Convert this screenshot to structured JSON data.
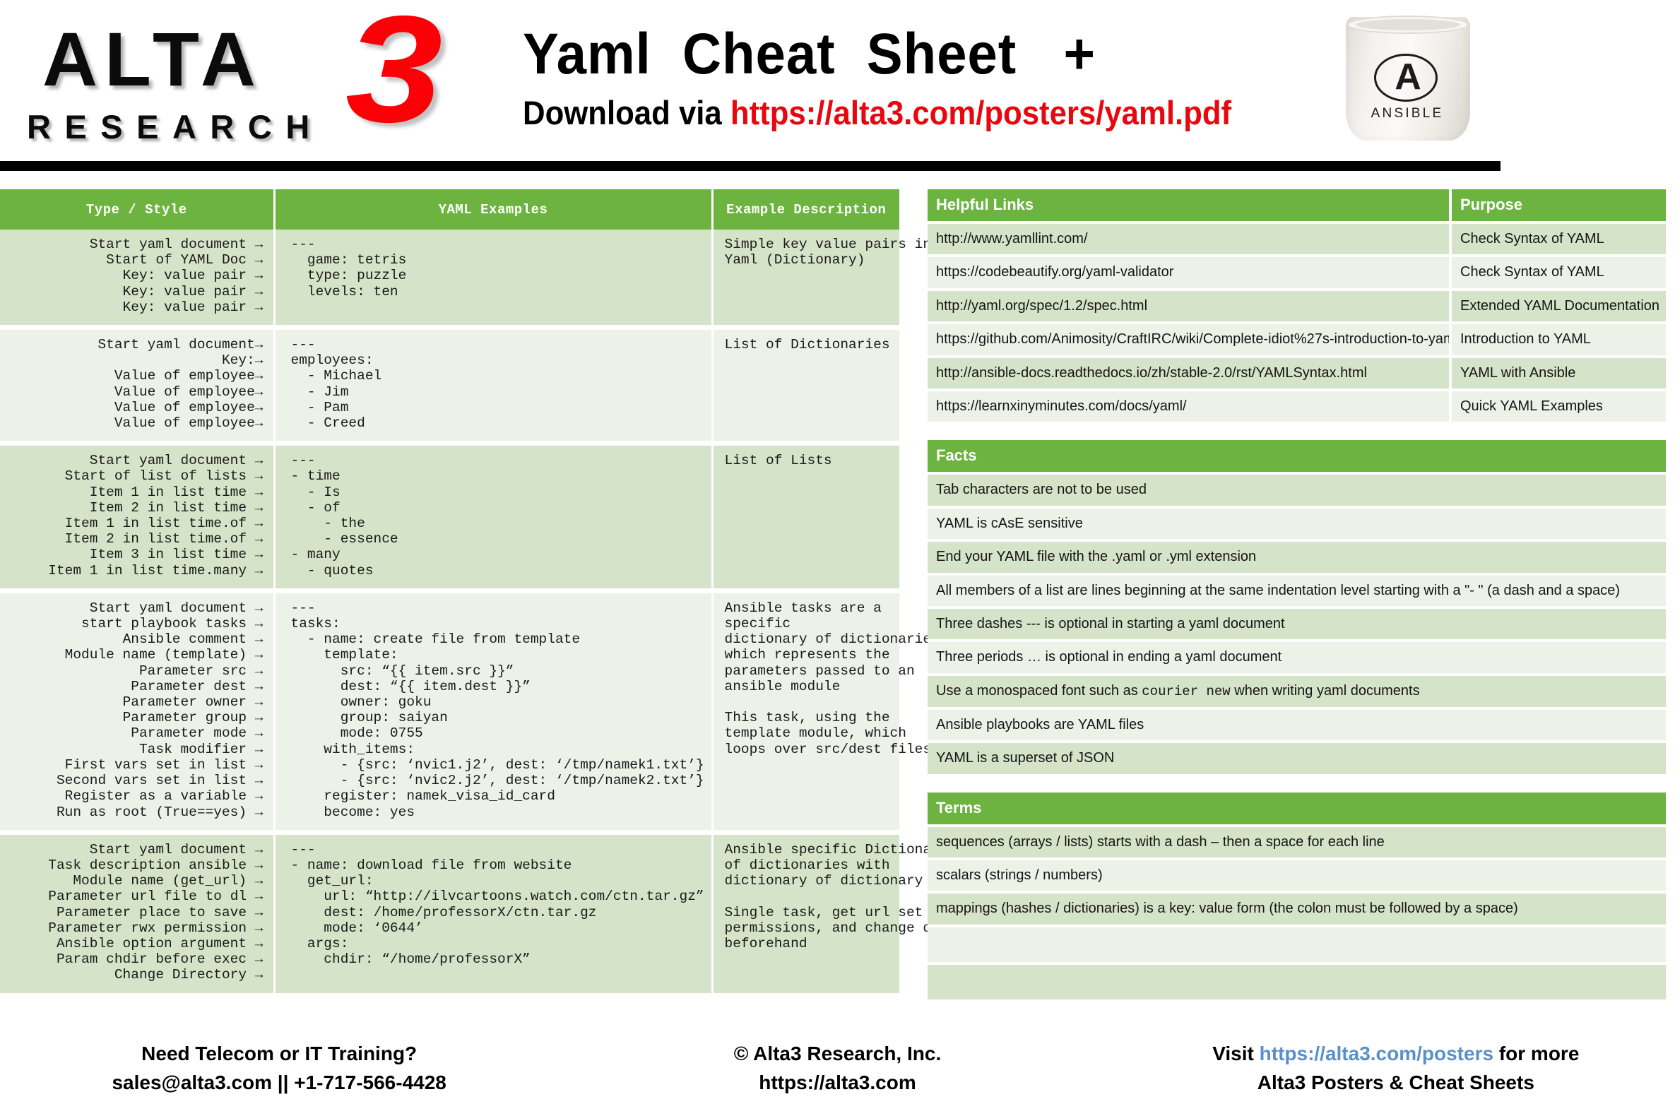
{
  "header": {
    "logo_alta": "ALTA",
    "logo_research": "RESEARCH",
    "logo_three": "3",
    "title": "Yaml  Cheat  Sheet   +",
    "subtitle_prefix": "Download via ",
    "subtitle_url": "https://alta3.com/posters/yaml.pdf",
    "mug_logo_mark": "A",
    "mug_logo_text": "ANSIBLE"
  },
  "cheat_table": {
    "headers": [
      "Type / Style",
      "YAML Examples",
      "Example Description"
    ],
    "rows": [
      {
        "type": "Start yaml document →\nStart of YAML Doc →\nKey: value pair →\nKey: value pair →\nKey: value pair →",
        "yaml": "---\n  game: tetris\n  type: puzzle\n  levels: ten",
        "desc": "Simple key value pairs in\nYaml (Dictionary)"
      },
      {
        "type": "Start yaml document→\nKey:→\nValue of employee→\nValue of employee→\nValue of employee→\nValue of employee→",
        "yaml": "---\nemployees:\n  - Michael\n  - Jim\n  - Pam\n  - Creed",
        "desc": "List of Dictionaries"
      },
      {
        "type": "Start yaml document →\nStart of list of lists →\nItem 1 in list time →\nItem 2 in list time →\nItem 1 in list time.of →\nItem 2 in list time.of →\nItem 3 in list time →\nItem 1 in list time.many →",
        "yaml": "---\n- time\n  - Is\n  - of\n    - the\n    - essence\n- many\n  - quotes",
        "desc": "List of Lists"
      },
      {
        "type": "Start yaml document →\nstart playbook tasks →\nAnsible comment →\nModule name (template) →\nParameter src →\nParameter dest →\nParameter owner →\nParameter group →\nParameter mode →\nTask modifier →\nFirst vars set in list →\nSecond vars set in list →\nRegister as a variable →\nRun as root (True==yes) →",
        "yaml": "---\ntasks:\n  - name: create file from template\n    template:\n      src: “{{ item.src }}”\n      dest: “{{ item.dest }}”\n      owner: goku\n      group: saiyan\n      mode: 0755\n    with_items:\n      - {src: ‘nvic1.j2’, dest: ‘/tmp/namek1.txt’}\n      - {src: ‘nvic2.j2’, dest: ‘/tmp/namek2.txt’}\n    register: namek_visa_id_card\n    become: yes",
        "desc": "Ansible tasks are a\nspecific\ndictionary of dictionaries\nwhich represents the\nparameters passed to an\nansible module\n\nThis task, using the\ntemplate module, which\nloops over src/dest files"
      },
      {
        "type": "Start yaml document →\nTask description ansible →\nModule name (get_url) →\nParameter url file to dl →\nParameter place to save →\nParameter rwx permission →\nAnsible option argument →\nParam chdir before exec →\nChange Directory →",
        "yaml": "---\n- name: download file from website\n  get_url:\n    url: “http://ilvcartoons.watch.com/ctn.tar.gz”\n    dest: /home/professorX/ctn.tar.gz\n    mode: ‘0644’\n  args:\n    chdir: “/home/professorX”",
        "desc": "Ansible specific Dictionary\nof dictionaries with\ndictionary of dictionary\n\nSingle task, get url set\npermissions, and change dir\nbeforehand"
      }
    ]
  },
  "helpful_links": {
    "title_links": "Helpful Links",
    "title_purpose": "Purpose",
    "rows": [
      {
        "url": "http://www.yamllint.com/",
        "purpose": "Check Syntax of YAML"
      },
      {
        "url": "https://codebeautify.org/yaml-validator",
        "purpose": "Check Syntax of YAML"
      },
      {
        "url": "http://yaml.org/spec/1.2/spec.html",
        "purpose": "Extended YAML Documentation"
      },
      {
        "url": "https://github.com/Animosity/CraftIRC/wiki/Complete-idiot%27s-introduction-to-yaml",
        "purpose": "Introduction to YAML"
      },
      {
        "url": "http://ansible-docs.readthedocs.io/zh/stable-2.0/rst/YAMLSyntax.html",
        "purpose": "YAML with Ansible"
      },
      {
        "url": "https://learnxinyminutes.com/docs/yaml/",
        "purpose": "Quick YAML Examples"
      }
    ]
  },
  "facts": {
    "title": "Facts",
    "rows": [
      {
        "text": "Tab characters are not to be used"
      },
      {
        "text": "YAML is cAsE sensitive"
      },
      {
        "text": "End your YAML file with the .yaml or .yml extension"
      },
      {
        "text": "All members of a list are lines beginning at the same indentation level starting with a \"- \" (a dash and a space)"
      },
      {
        "text": "Three dashes --- is optional in starting a yaml document"
      },
      {
        "text": "Three periods … is optional in ending a yaml document"
      },
      {
        "text": "Use a monospaced font such as ",
        "mono": "courier new",
        "text_after": " when writing yaml documents"
      },
      {
        "text": "Ansible playbooks are YAML files"
      },
      {
        "text": "YAML is a superset of JSON"
      }
    ]
  },
  "terms": {
    "title": "Terms",
    "rows": [
      {
        "text": "sequences (arrays / lists) starts with a dash – then a space for each line"
      },
      {
        "text": "scalars (strings / numbers)"
      },
      {
        "text": "mappings (hashes / dictionaries) is a key: value form (the colon must be followed by a space)"
      },
      {
        "text": ""
      },
      {
        "text": ""
      }
    ]
  },
  "footer": {
    "col1_line1": "Need Telecom or IT Training?",
    "col1_line2": "sales@alta3.com || +1-717-566-4428",
    "col2_line1": "© Alta3 Research, Inc.",
    "col2_line2": "https://alta3.com",
    "col3_prefix": "Visit ",
    "col3_link": "https://alta3.com/posters",
    "col3_suffix": " for more",
    "col3_line2": "Alta3 Posters & Cheat Sheets"
  },
  "colors": {
    "green_header": "#6cb33f",
    "band_a": "#d5e3c8",
    "band_b": "#edf2e8",
    "red": "#e8070f",
    "blue_link": "#5b8fc9"
  }
}
